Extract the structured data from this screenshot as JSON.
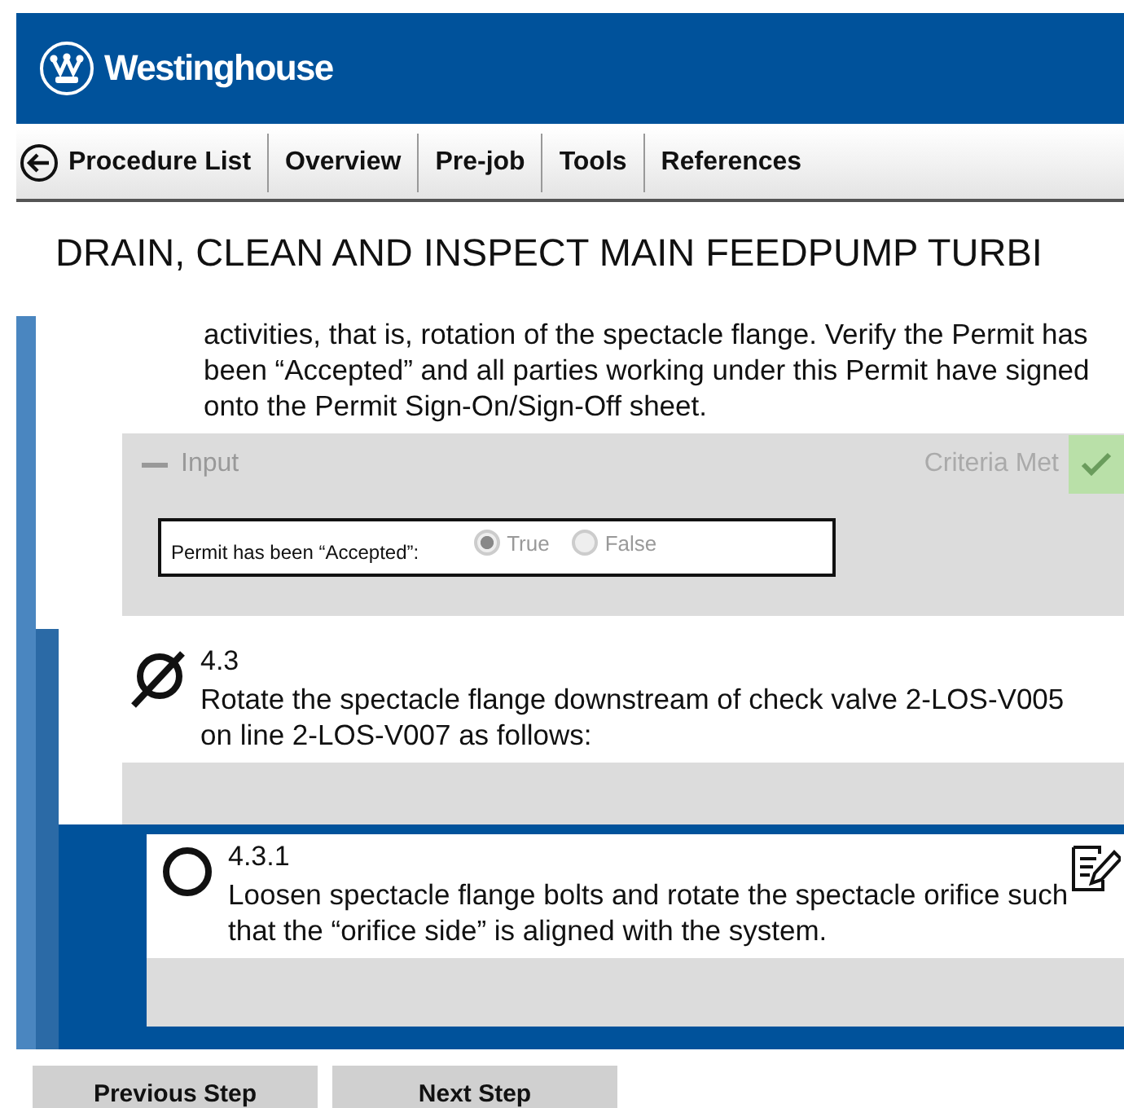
{
  "header": {
    "brand": "Westinghouse"
  },
  "nav": {
    "back_label": "Procedure List",
    "tabs": [
      {
        "label": "Overview"
      },
      {
        "label": "Pre-job"
      },
      {
        "label": "Tools"
      },
      {
        "label": "References"
      }
    ]
  },
  "title": "DRAIN, CLEAN AND INSPECT MAIN FEEDPUMP TURBI",
  "intro": {
    "text": "activities, that is, rotation of the spectacle flange. Verify the Permit has been “Accepted” and all parties working under this Permit have signed onto the Permit Sign-On/Sign-Off sheet.",
    "input": {
      "label": "Input",
      "expanded": true,
      "status": "Criteria Met",
      "met": true,
      "question": "Permit has been “Accepted”:",
      "options": [
        {
          "label": "True",
          "selected": true
        },
        {
          "label": "False",
          "selected": false
        }
      ]
    }
  },
  "steps": [
    {
      "number": "4.3",
      "skipped": true,
      "current": false,
      "editable": false,
      "text": "Rotate the spectacle flange downstream of check valve 2-LOS-V005 on line 2-LOS-V007 as follows:"
    },
    {
      "number": "4.3.1",
      "skipped": false,
      "current": true,
      "editable": true,
      "text": "Loosen spectacle flange bolts and rotate the spectacle orifice such that the “orifice side” is aligned with the system."
    }
  ],
  "buttons": [
    "Previous Step",
    "Next Step"
  ]
}
